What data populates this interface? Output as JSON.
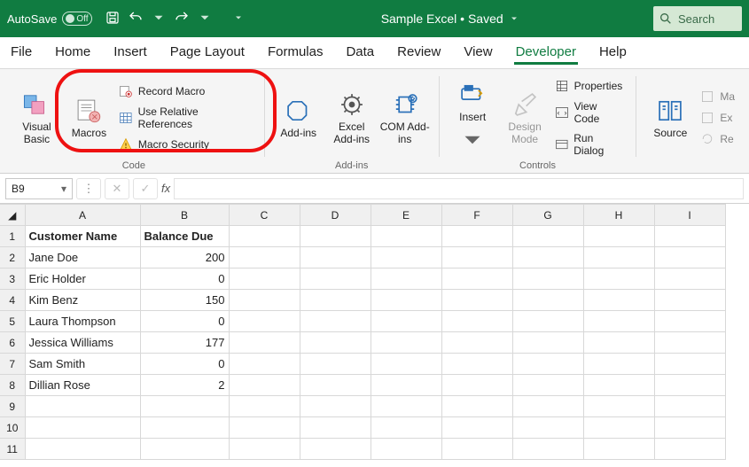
{
  "titlebar": {
    "autosave_label": "AutoSave",
    "toggle_state": "Off",
    "doc_title": "Sample Excel • Saved",
    "search_placeholder": "Search"
  },
  "tabs": {
    "file": "File",
    "home": "Home",
    "insert": "Insert",
    "page_layout": "Page Layout",
    "formulas": "Formulas",
    "data": "Data",
    "review": "Review",
    "view": "View",
    "developer": "Developer",
    "help": "Help"
  },
  "ribbon": {
    "code_group": "Code",
    "visual_basic": "Visual Basic",
    "macros": "Macros",
    "record_macro": "Record Macro",
    "use_relative": "Use Relative References",
    "macro_security": "Macro Security",
    "addins_group": "Add-ins",
    "add_ins": "Add-ins",
    "excel_addins": "Excel Add-ins",
    "com_addins": "COM Add-ins",
    "controls_group": "Controls",
    "insert_btn": "Insert",
    "design_mode": "Design Mode",
    "properties": "Properties",
    "view_code": "View Code",
    "run_dialog": "Run Dialog",
    "source": "Source",
    "map": "Ma",
    "ex": "Ex",
    "re": "Re"
  },
  "formulabar": {
    "namebox": "B9",
    "fx": "fx"
  },
  "sheet": {
    "cols": [
      "A",
      "B",
      "C",
      "D",
      "E",
      "F",
      "G",
      "H",
      "I"
    ],
    "headers": {
      "A": "Customer Name",
      "B": "Balance Due"
    },
    "rows": [
      {
        "A": "Jane Doe",
        "B": "200"
      },
      {
        "A": "Eric Holder",
        "B": "0"
      },
      {
        "A": "Kim Benz",
        "B": "150"
      },
      {
        "A": "Laura Thompson",
        "B": "0"
      },
      {
        "A": "Jessica Williams",
        "B": "177"
      },
      {
        "A": "Sam Smith",
        "B": "0"
      },
      {
        "A": "Dillian Rose",
        "B": "2"
      }
    ]
  }
}
